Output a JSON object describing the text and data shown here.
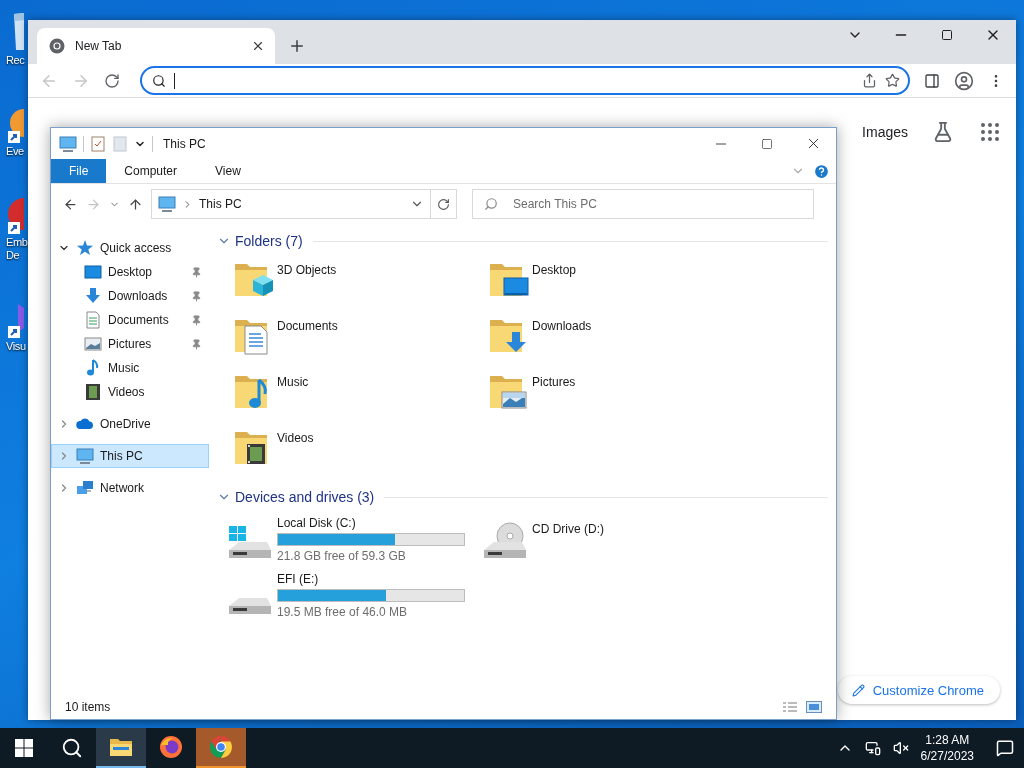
{
  "desktop_icons": [
    {
      "kind": "recycle-bin",
      "lines": [
        "Rec"
      ]
    },
    {
      "kind": "app-orange",
      "lines": [
        "Eve"
      ]
    },
    {
      "kind": "app-red",
      "lines": [
        "Emb",
        "De"
      ]
    },
    {
      "kind": "app-purple",
      "lines": [
        "Visu"
      ]
    }
  ],
  "browser": {
    "tab": {
      "title": "New Tab"
    },
    "links": [
      "Images"
    ],
    "customize": "Customize Chrome"
  },
  "explorer": {
    "title": "This PC",
    "ribbon_tabs": [
      {
        "label": "File",
        "selected": true
      },
      {
        "label": "Computer",
        "selected": false
      },
      {
        "label": "View",
        "selected": false
      }
    ],
    "address": "This PC",
    "search": {
      "placeholder": "Search This PC"
    },
    "nav": [
      {
        "label": "Quick access",
        "kind": "star",
        "expanded": true,
        "selected": false,
        "children": [
          {
            "label": "Desktop",
            "kind": "desktop",
            "pinned": true,
            "selected": false
          },
          {
            "label": "Downloads",
            "kind": "downloads",
            "pinned": true,
            "selected": false
          },
          {
            "label": "Documents",
            "kind": "documents",
            "pinned": true,
            "selected": false
          },
          {
            "label": "Pictures",
            "kind": "pictures",
            "pinned": true,
            "selected": false
          },
          {
            "label": "Music",
            "kind": "music",
            "pinned": false,
            "selected": false
          },
          {
            "label": "Videos",
            "kind": "videos",
            "pinned": false,
            "selected": false
          }
        ]
      },
      {
        "label": "OneDrive",
        "kind": "cloud",
        "expanded": false,
        "selected": false
      },
      {
        "label": "This PC",
        "kind": "pc",
        "expanded": false,
        "selected": true
      },
      {
        "label": "Network",
        "kind": "network",
        "expanded": false,
        "selected": false
      }
    ],
    "groups": [
      {
        "title": "Folders (7)",
        "kind": "folders",
        "expanded": true,
        "items": [
          {
            "name": "3D Objects",
            "kind": "objects"
          },
          {
            "name": "Desktop",
            "kind": "desktop"
          },
          {
            "name": "Documents",
            "kind": "documents"
          },
          {
            "name": "Downloads",
            "kind": "downloads"
          },
          {
            "name": "Music",
            "kind": "music"
          },
          {
            "name": "Pictures",
            "kind": "pictures"
          },
          {
            "name": "Videos",
            "kind": "videos"
          }
        ]
      },
      {
        "title": "Devices and drives (3)",
        "kind": "drives",
        "expanded": true,
        "items": [
          {
            "name": "Local Disk (C:)",
            "kind": "system-disk",
            "level": 0.63,
            "detail": "21.8 GB free of 59.3 GB"
          },
          {
            "name": "CD Drive (D:)",
            "kind": "cd"
          },
          {
            "name": "EFI (E:)",
            "kind": "disk",
            "level": 0.58,
            "detail": "19.5 MB free of 46.0 MB"
          }
        ]
      }
    ],
    "status": "10 items"
  },
  "taskbar": {
    "apps": [
      {
        "kind": "file-explorer",
        "running": true,
        "flashing": false
      },
      {
        "kind": "firefox",
        "running": false,
        "flashing": false
      },
      {
        "kind": "chrome",
        "running": true,
        "flashing": true
      }
    ],
    "clock": {
      "time": "1:28 AM",
      "date": "6/27/2023"
    }
  }
}
